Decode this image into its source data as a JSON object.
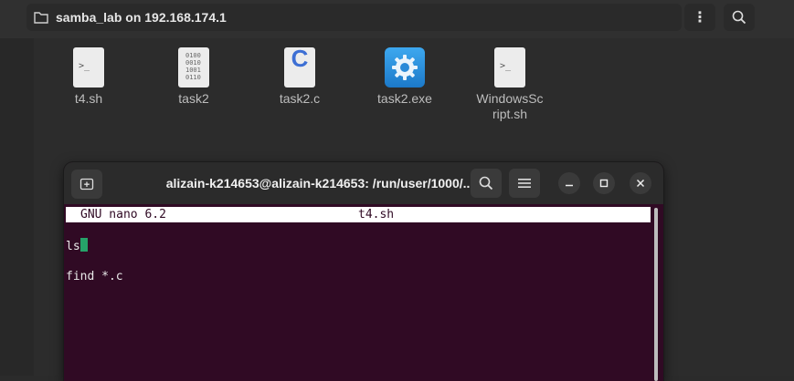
{
  "files_window": {
    "location": "samba_lab on 192.168.174.1",
    "menu_glyph": "⋮"
  },
  "files": [
    {
      "name": "t4.sh",
      "icon": "shell-script-icon",
      "glyph": ">_"
    },
    {
      "name": "task2",
      "icon": "binary-file-icon",
      "glyph": "0100\n0010\n1001\n0110"
    },
    {
      "name": "task2.c",
      "icon": "c-source-icon",
      "glyph": "C"
    },
    {
      "name": "task2.exe",
      "icon": "exe-gear-icon"
    },
    {
      "name": "WindowsScript.sh",
      "name_lines": [
        "WindowsSc",
        "ript.sh"
      ],
      "icon": "shell-script-icon",
      "glyph": ">_"
    }
  ],
  "terminal": {
    "title": "alizain-k214653@alizain-k214653: /run/user/1000/...",
    "nano_version": "GNU nano 6.2",
    "nano_filename": "t4.sh",
    "lines": [
      "ls",
      "find *.c"
    ]
  },
  "colors": {
    "terminal_bg": "#300a24",
    "cursor": "#26a269"
  }
}
